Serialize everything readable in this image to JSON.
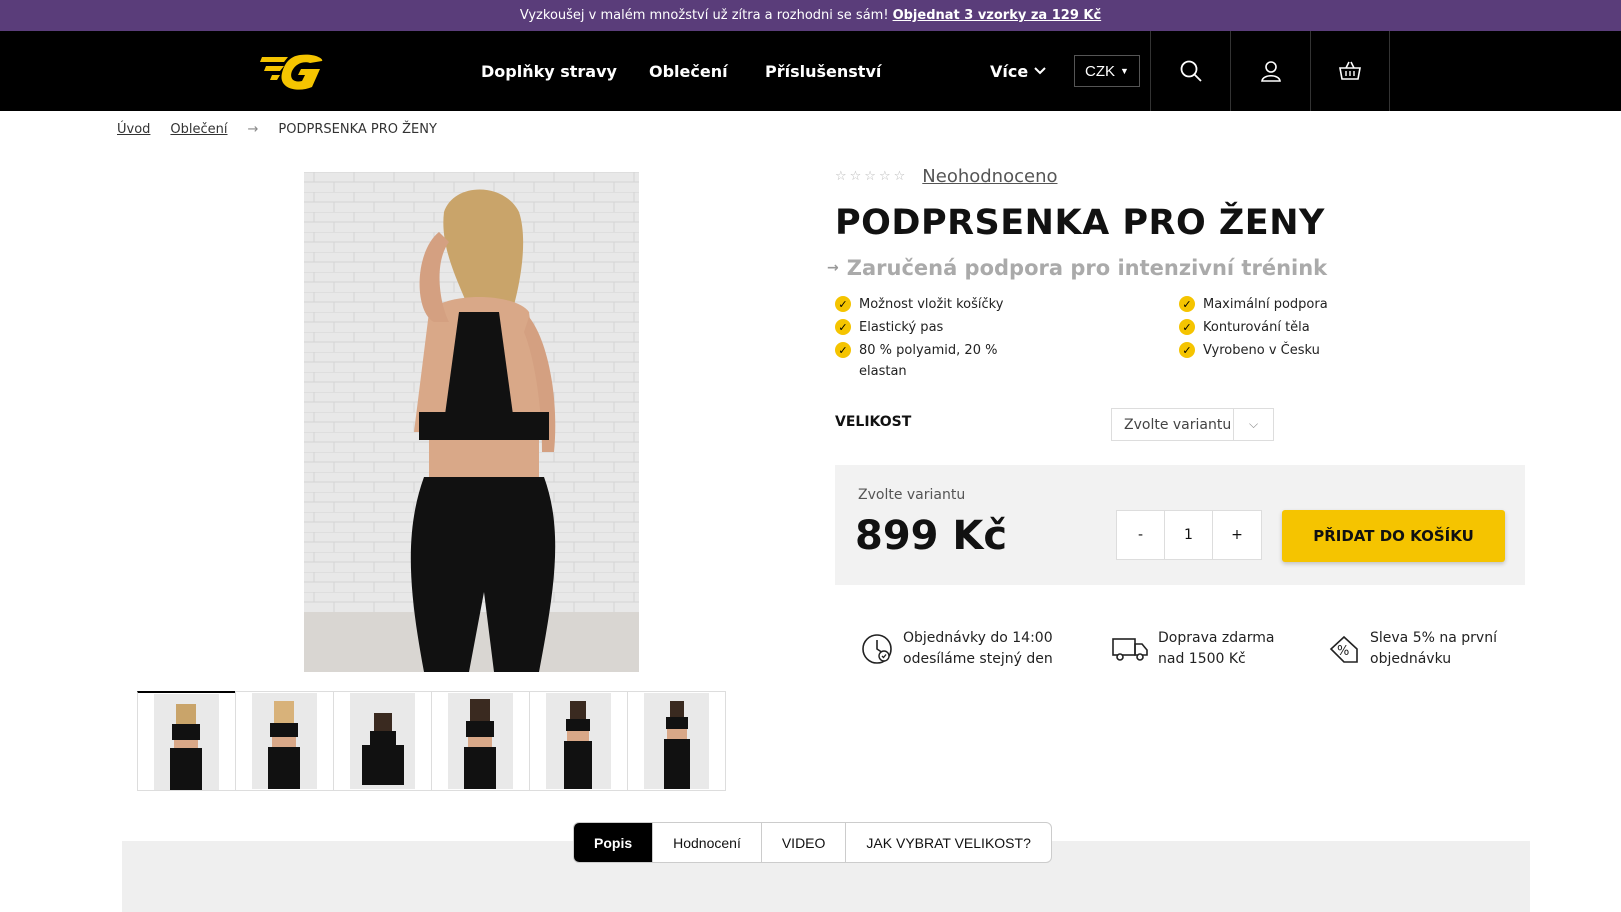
{
  "promo": {
    "text": "Vyzkoušej v malém množství už zítra a rozhodni se sám!",
    "link": "Objednat 3 vzorky za 129 Kč"
  },
  "nav": {
    "items": [
      "Doplňky stravy",
      "Oblečení",
      "Příslušenství"
    ],
    "more": "Více",
    "currency": "CZK"
  },
  "breadcrumb": {
    "home": "Úvod",
    "category": "Oblečení",
    "current": "PODPRSENKA PRO ŽENY"
  },
  "product": {
    "rating_text": "Neohodnoceno",
    "title": "PODPRSENKA PRO ŽENY",
    "subtitle": "Zaručená podpora pro intenzivní trénink",
    "features_left": [
      "Možnost vložit košíčky",
      "Elastický pas",
      "80 % polyamid, 20 % elastan"
    ],
    "features_right": [
      "Maximální podpora",
      "Konturování těla",
      "Vyrobeno v Česku"
    ],
    "size_label": "VELIKOST",
    "size_select": "Zvolte variantu",
    "variant_label": "Zvolte variantu",
    "price": "899 Kč",
    "qty_minus": "-",
    "qty_value": "1",
    "qty_plus": "+",
    "add_to_cart": "PŘIDAT DO KOŠÍKU"
  },
  "usps": [
    {
      "line1": "Objednávky do 14:00",
      "line2": "odesíláme stejný den",
      "icon": "clock-icon"
    },
    {
      "line1": "Doprava zdarma",
      "line2": "nad 1500 Kč",
      "icon": "truck-icon"
    },
    {
      "line1": "Sleva 5% na první",
      "line2": "objednávku",
      "icon": "discount-tag-icon"
    }
  ],
  "tabs": [
    "Popis",
    "Hodnocení",
    "VIDEO",
    "JAK VYBRAT VELIKOST?"
  ],
  "colors": {
    "promo_bg": "#5a3d7a",
    "header_bg": "#000000",
    "accent": "#f5c400"
  }
}
